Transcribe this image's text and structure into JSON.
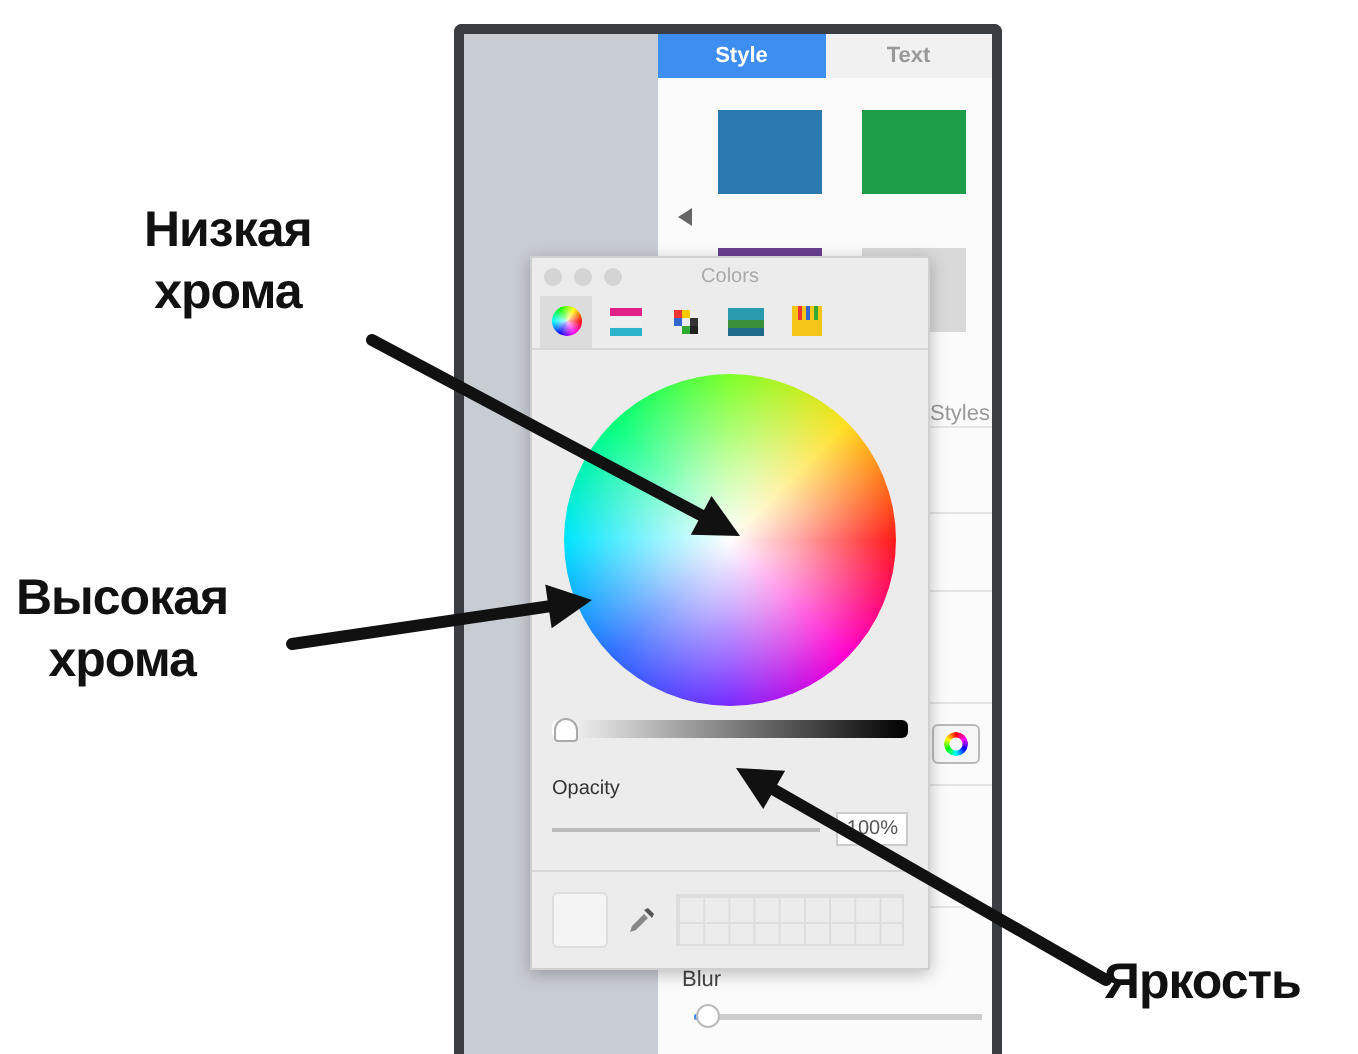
{
  "inspector": {
    "tabs": [
      {
        "label": "Style",
        "selected": true
      },
      {
        "label": "Text",
        "selected": false
      }
    ],
    "swatches": [
      {
        "color": "#2a7ab0"
      },
      {
        "color": "#1f9e4a"
      },
      {
        "color": "#6b3f8f"
      },
      {
        "color": "#d9d9d9"
      }
    ],
    "styles_label": "Styles",
    "blur_label": "Blur",
    "blur": {
      "level": 0.05
    }
  },
  "colors_window": {
    "title": "Colors",
    "modes": [
      {
        "selected": true
      },
      {
        "selected": false
      },
      {
        "selected": false
      },
      {
        "selected": false
      },
      {
        "selected": false
      }
    ],
    "brightness": {
      "level": 0.04
    },
    "opacity_label": "Opacity",
    "opacity": {
      "level": 1,
      "value": "100%"
    }
  },
  "annotations": [
    {
      "text": "Низкая\nхрома"
    },
    {
      "text": "Высокая\nхрома"
    },
    {
      "text": "Яркость"
    }
  ]
}
